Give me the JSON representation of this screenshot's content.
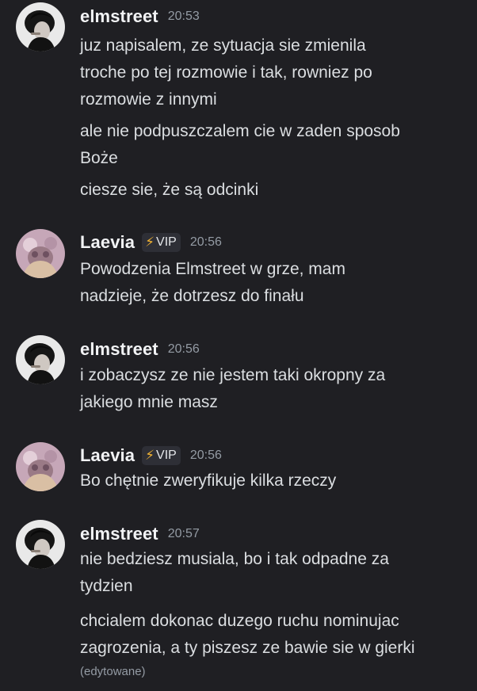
{
  "messages": [
    {
      "username": "elmstreet",
      "avatar_icon": "user-avatar-dark-hair-icon",
      "vip": false,
      "time": "20:53",
      "lines": [
        "juz napisalem, ze sytuacja sie zmienila",
        "troche po tej rozmowie i tak, rowniez po",
        "rozmowie z innymi",
        "ale nie podpuszczalem cie w zaden sposob",
        "Boże",
        "ciesze sie, że są odcinki"
      ]
    },
    {
      "username": "Laevia",
      "avatar_icon": "user-avatar-pink-icon",
      "vip": true,
      "vip_label": "VIP",
      "vip_icon": "lightning-bolt-icon",
      "time": "20:56",
      "lines": [
        "Powodzenia Elmstreet w grze, mam",
        "nadzieje, że dotrzesz do finału"
      ]
    },
    {
      "username": "elmstreet",
      "avatar_icon": "user-avatar-dark-hair-icon",
      "vip": false,
      "time": "20:56",
      "lines": [
        "i zobaczysz ze nie jestem taki okropny za",
        "jakiego mnie masz"
      ]
    },
    {
      "username": "Laevia",
      "avatar_icon": "user-avatar-pink-icon",
      "vip": true,
      "vip_label": "VIP",
      "vip_icon": "lightning-bolt-icon",
      "time": "20:56",
      "lines": [
        "Bo chętnie zweryfikuje kilka rzeczy"
      ]
    },
    {
      "username": "elmstreet",
      "avatar_icon": "user-avatar-dark-hair-icon",
      "vip": false,
      "time": "20:57",
      "lines": [
        "nie bedziesz musiala, bo i tak odpadne za",
        "tydzien",
        "chcialem dokonac duzego ruchu nominujac",
        "zagrozenia, a ty piszesz ze bawie sie w gierki"
      ],
      "edited_label": "(edytowane)"
    }
  ],
  "colors": {
    "background": "#1f1f23",
    "text": "#dbdee1",
    "username": "#f2f3f5",
    "muted": "#949ba4",
    "vip_bolt": "#f0b232",
    "vip_badge_bg": "#2e2f36"
  }
}
